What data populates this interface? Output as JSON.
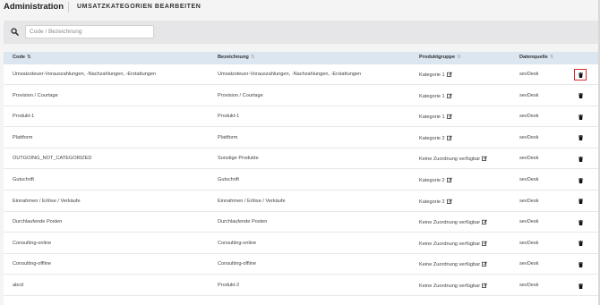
{
  "header": {
    "app_title": "Administration",
    "page_title": "UMSATZKATEGORIEN BEARBEITEN"
  },
  "search": {
    "placeholder": "Code / Bezeichnung",
    "value": ""
  },
  "table": {
    "columns": [
      "Code",
      "Bezeichnung",
      "Produktgruppe",
      "Datenquelle"
    ],
    "sort_active_column": "Code",
    "rows": [
      {
        "code": "Umsatzsteuer-Vorauszahlungen, -Nachzahlungen, -Erstattungen",
        "name": "Umsatzsteuer-Vorauszahlungen, -Nachzahlungen, -Erstattungen",
        "group": "Kategorie 1",
        "source": "sevDesk",
        "highlighted": true
      },
      {
        "code": "Provision / Courtage",
        "name": "Provision / Courtage",
        "group": "Kategorie 1",
        "source": "sevDesk",
        "highlighted": false
      },
      {
        "code": "Produkt-1",
        "name": "Produkt-1",
        "group": "Kategorie 1",
        "source": "sevDesk",
        "highlighted": false
      },
      {
        "code": "Plattform",
        "name": "Plattform",
        "group": "Kategorie 2",
        "source": "sevDesk",
        "highlighted": false
      },
      {
        "code": "OUTGOING_NOT_CATEGORIZED",
        "name": "Sonstige Produkte",
        "group": "Keine Zuordnung verfügbar",
        "source": "sevDesk",
        "highlighted": false
      },
      {
        "code": "Gutschrift",
        "name": "Gutschrift",
        "group": "Kategorie 2",
        "source": "sevDesk",
        "highlighted": false
      },
      {
        "code": "Einnahmen / Erlöse / Verkäufe",
        "name": "Einnahmen / Erlöse / Verkäufe",
        "group": "Kategorie 2",
        "source": "sevDesk",
        "highlighted": false
      },
      {
        "code": "Durchlaufende Posten",
        "name": "Durchlaufende Posten",
        "group": "Keine Zuordnung verfügbar",
        "source": "sevDesk",
        "highlighted": false
      },
      {
        "code": "Consulting-online",
        "name": "Consulting-online",
        "group": "Keine Zuordnung verfügbar",
        "source": "sevDesk",
        "highlighted": false
      },
      {
        "code": "Consulting-offline",
        "name": "Consulting-offline",
        "group": "Keine Zuordnung verfügbar",
        "source": "sevDesk",
        "highlighted": false
      },
      {
        "code": "abcd",
        "name": "Produkt-2",
        "group": "Keine Zuordnung verfügbar",
        "source": "sevDesk",
        "highlighted": false
      }
    ]
  },
  "icons": {
    "search": "search-icon",
    "sort": "sort-icon",
    "edit": "edit-icon",
    "delete": "trash-icon"
  },
  "colors": {
    "header_bg": "#dbe6f1",
    "highlight_border": "#e0262e"
  }
}
